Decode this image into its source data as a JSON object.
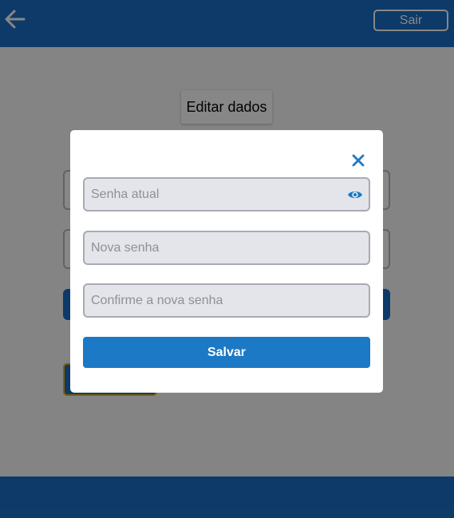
{
  "header": {
    "back_icon": "arrow-left-icon",
    "exit_label": "Sair"
  },
  "page": {
    "heading": "Editar dados"
  },
  "modal": {
    "close_icon": "close-icon",
    "fields": [
      {
        "placeholder": "Senha atual",
        "value": "",
        "icon": "eye-icon"
      },
      {
        "placeholder": "Nova senha",
        "value": ""
      },
      {
        "placeholder": "Confirme a nova senha",
        "value": ""
      }
    ],
    "save_label": "Salvar"
  },
  "colors": {
    "header_blue": "#1a6fc4",
    "button_blue": "#1c79c6",
    "input_fill": "#e4e5ea",
    "accent_yellow": "#f1b400"
  }
}
